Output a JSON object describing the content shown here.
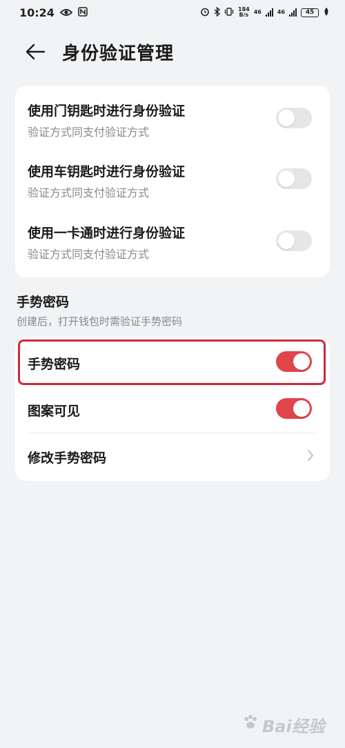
{
  "status_bar": {
    "time": "10:24",
    "net_speed_top": "184",
    "net_speed_bottom": "B/s",
    "signal_label_1": "46",
    "signal_label_2": "46",
    "battery": "45"
  },
  "header": {
    "title": "身份验证管理"
  },
  "auth_items": [
    {
      "title": "使用门钥匙时进行身份验证",
      "subtitle": "验证方式同支付验证方式",
      "enabled": false
    },
    {
      "title": "使用车钥匙时进行身份验证",
      "subtitle": "验证方式同支付验证方式",
      "enabled": false
    },
    {
      "title": "使用一卡通时进行身份验证",
      "subtitle": "验证方式同支付验证方式",
      "enabled": false
    }
  ],
  "gesture_section": {
    "title": "手势密码",
    "subtitle": "创建后，打开钱包时需验证手势密码",
    "items": [
      {
        "title": "手势密码",
        "enabled": true
      },
      {
        "title": "图案可见",
        "enabled": true
      },
      {
        "title": "修改手势密码"
      }
    ]
  },
  "watermark": {
    "text": "Bai经验"
  },
  "colors": {
    "accent": "#e0454a",
    "highlight": "#d0283a",
    "background": "#f1f3f5"
  }
}
